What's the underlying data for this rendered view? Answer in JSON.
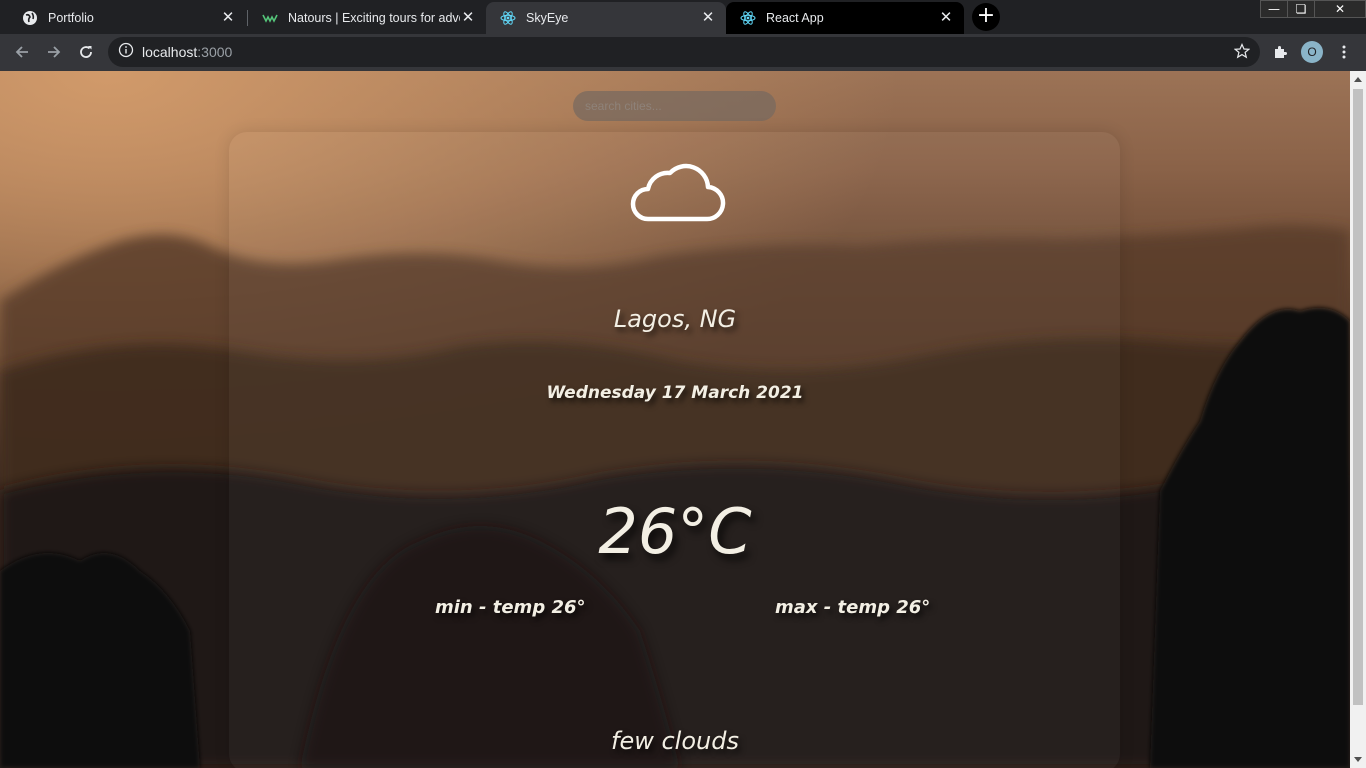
{
  "tabs": [
    {
      "title": "Portfolio",
      "icon": "globe-icon",
      "active": false
    },
    {
      "title": "Natours | Exciting tours for adventurous people",
      "icon": "natours-logo-icon",
      "active": false
    },
    {
      "title": "SkyEye",
      "icon": "react-logo-icon",
      "active": true
    },
    {
      "title": "React App",
      "icon": "react-logo-icon",
      "active": false
    }
  ],
  "toolbar": {
    "url_host": "localhost",
    "url_port": ":3000",
    "profile_initial": "O"
  },
  "weather": {
    "search_placeholder": "search cities...",
    "icon": "cloud-icon",
    "city": "Lagos, NG",
    "date": "Wednesday 17 March 2021",
    "temperature": "26°C",
    "min_temp": "min - temp 26°",
    "max_temp": "max - temp 26°",
    "description": "few clouds"
  },
  "colors": {
    "text": "#f3efe4",
    "chrome_dark": "#202124",
    "chrome_toolbar": "#35363a",
    "react_blue": "#61dafb"
  }
}
